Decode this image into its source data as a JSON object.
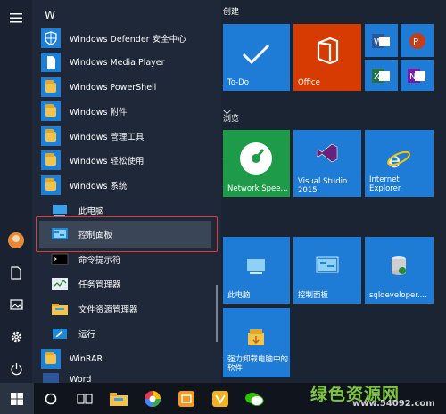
{
  "app_list": {
    "letters": {
      "w": "W"
    },
    "items": [
      {
        "label": "Windows Defender 安全中心",
        "icon": "shield-icon"
      },
      {
        "label": "Windows Media Player",
        "icon": "document-icon"
      },
      {
        "label": "Windows PowerShell",
        "icon": "folder-icon"
      },
      {
        "label": "Windows 附件",
        "icon": "folder-icon"
      },
      {
        "label": "Windows 管理工具",
        "icon": "folder-icon"
      },
      {
        "label": "Windows 轻松使用",
        "icon": "folder-icon"
      },
      {
        "label": "Windows 系统",
        "icon": "folder-icon"
      }
    ],
    "system_items": [
      {
        "label": "此电脑",
        "icon": "computer-icon"
      },
      {
        "label": "控制面板",
        "icon": "control-panel-icon"
      },
      {
        "label": "命令提示符",
        "icon": "cmd-icon"
      },
      {
        "label": "任务管理器",
        "icon": "task-manager-icon"
      },
      {
        "label": "文件资源管理器",
        "icon": "file-explorer-icon"
      },
      {
        "label": "运行",
        "icon": "run-icon"
      }
    ],
    "after_items": [
      {
        "label": "WinRAR",
        "icon": "folder-icon"
      },
      {
        "label": "Word",
        "icon": "word-icon"
      }
    ]
  },
  "tiles": {
    "group_create": "创建",
    "group_browse": "浏览",
    "todo": "To-Do",
    "office": "Office",
    "network": "Network Spee...",
    "vs": "Visual Studio 2015",
    "ie": "Internet Explorer",
    "this_pc": "此电脑",
    "control_panel": "控制面板",
    "sql": "sqldeveloper....",
    "uninstall": "强力卸载电脑中的软件"
  },
  "watermark": {
    "text": "绿色资源网",
    "url": "www.54092.com"
  },
  "colors": {
    "tile_blue": "#1e7bd6",
    "office_red": "#d83b01",
    "network_green": "#1d9b49",
    "highlight_red": "#e03a3a"
  }
}
